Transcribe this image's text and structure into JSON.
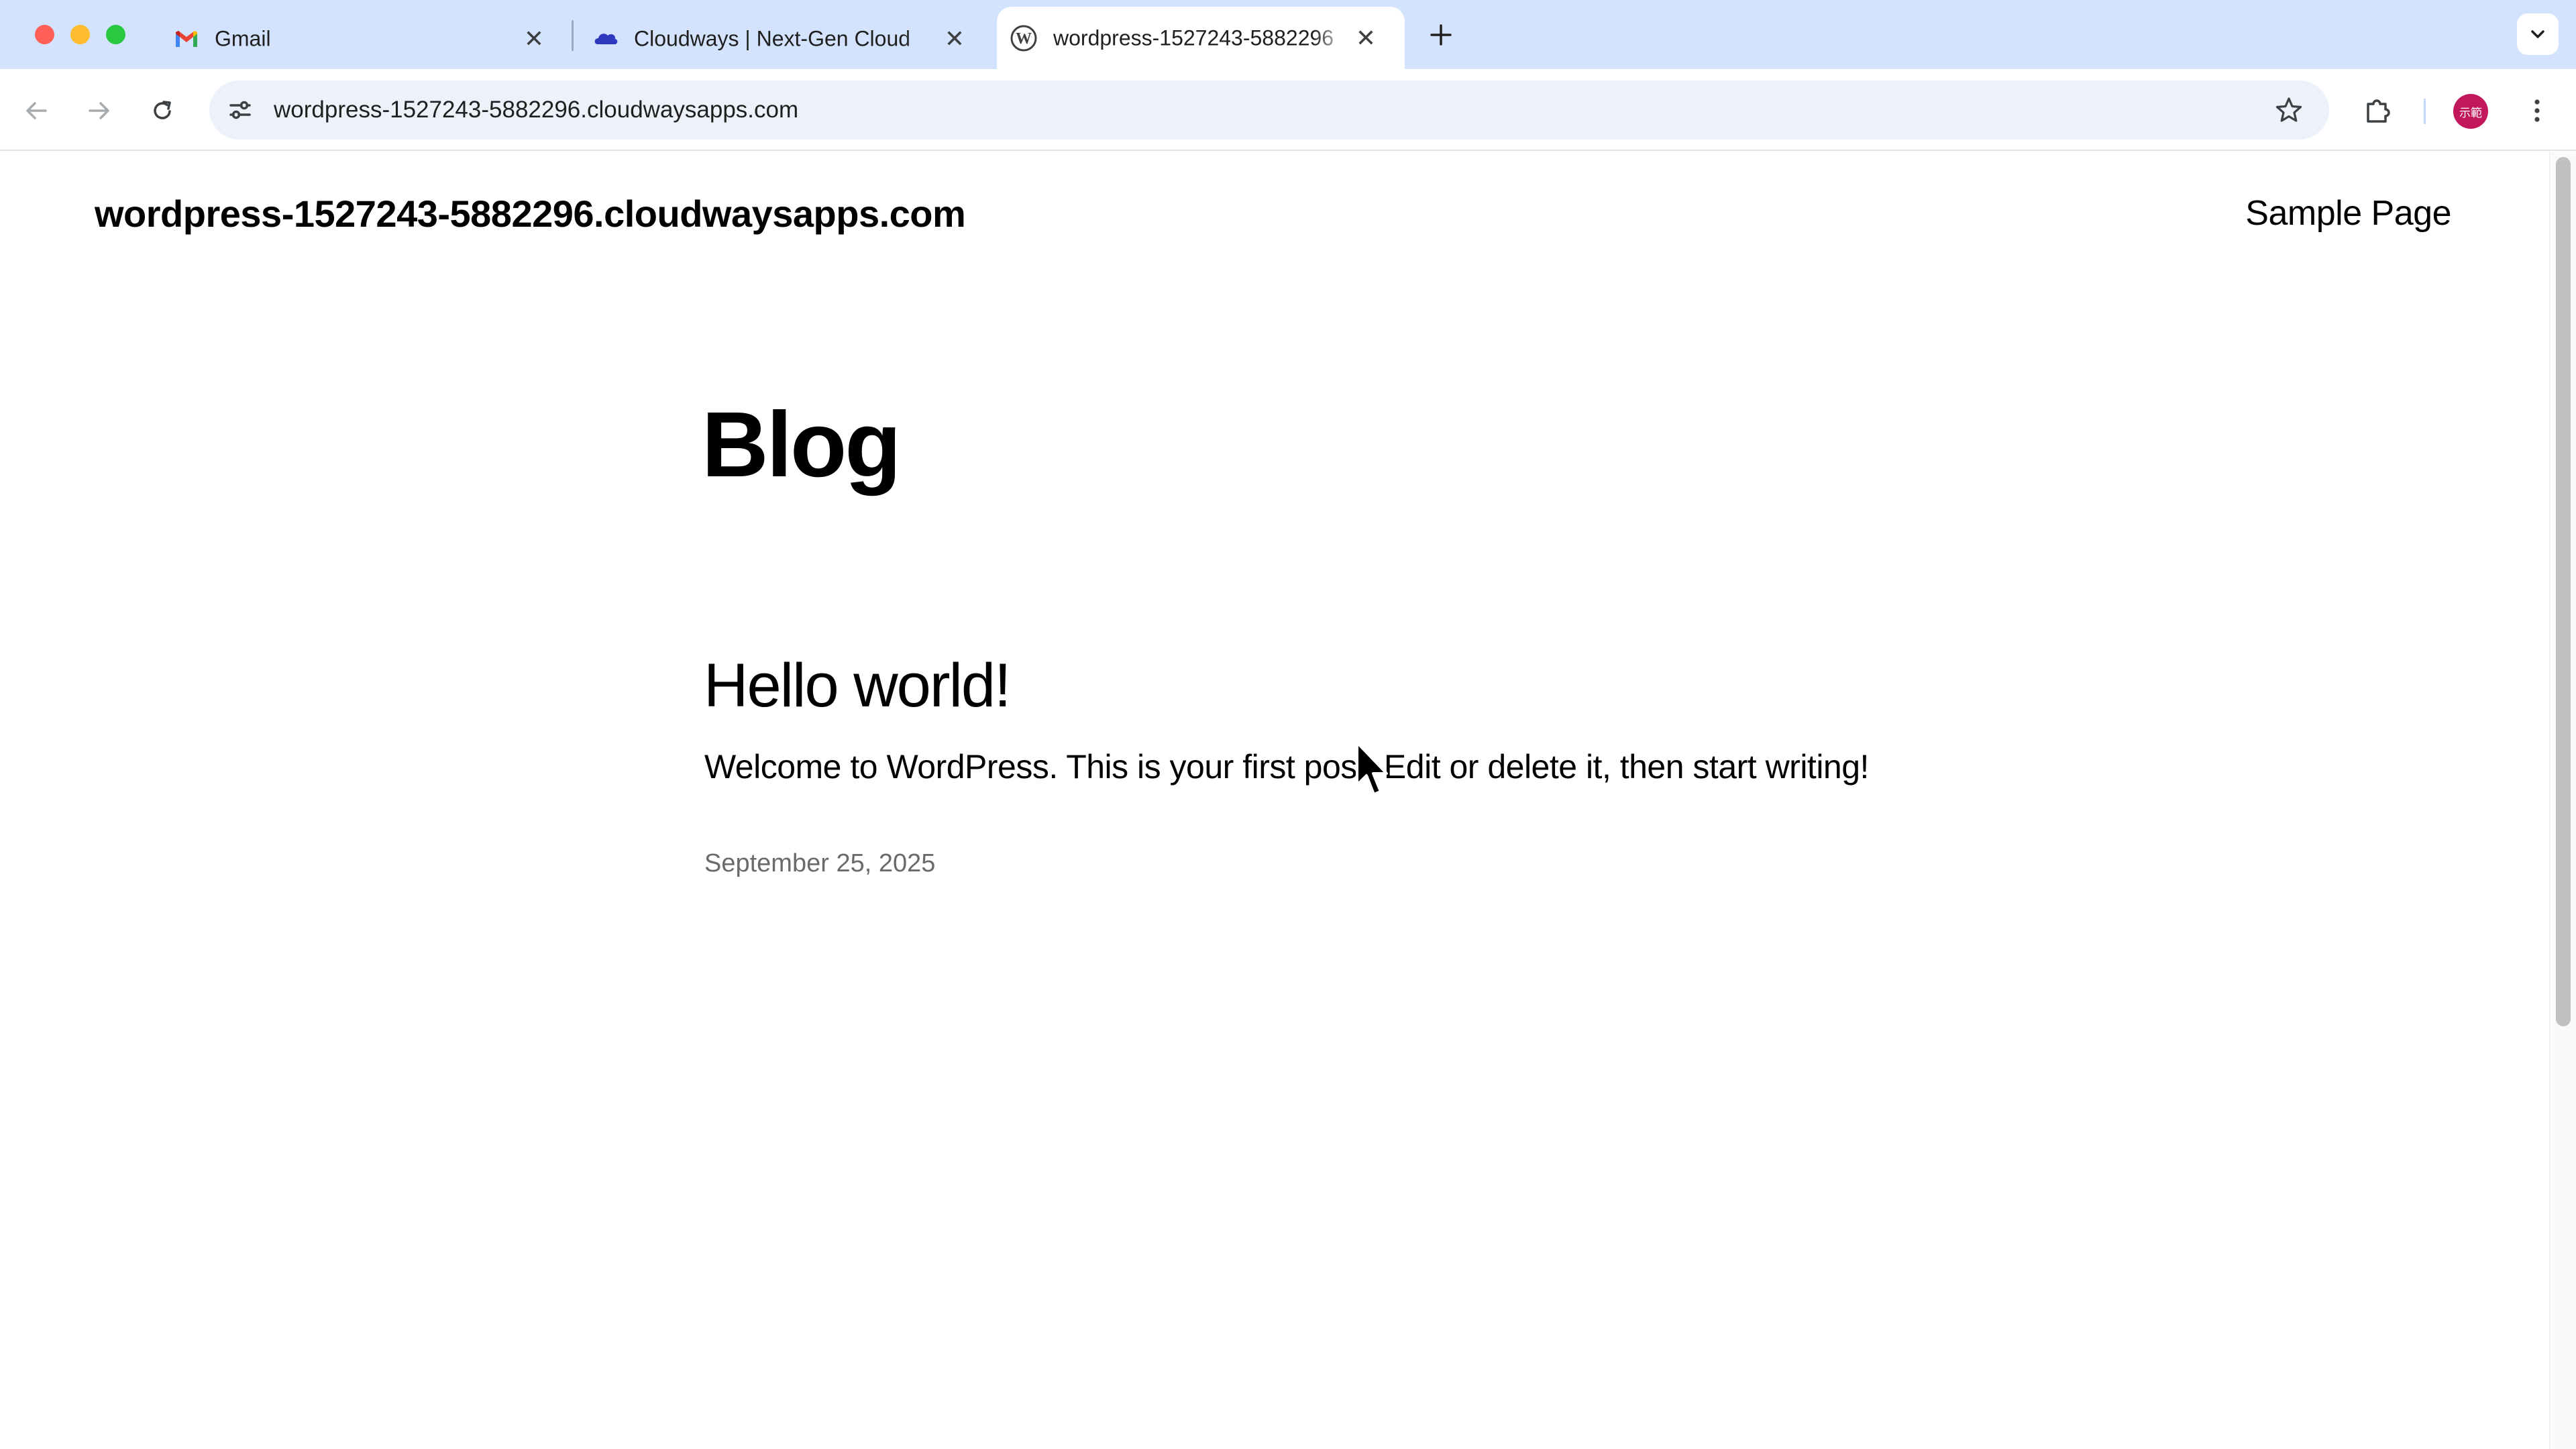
{
  "browser": {
    "tabs": [
      {
        "title": "Gmail",
        "favicon": "gmail-icon",
        "active": false
      },
      {
        "title": "Cloudways | Next-Gen Cloud",
        "favicon": "cloudways-icon",
        "active": false
      },
      {
        "title": "wordpress-1527243-5882296",
        "favicon": "wordpress-icon",
        "active": true
      }
    ],
    "url": "wordpress-1527243-5882296.cloudwaysapps.com",
    "profile_initials": "示範"
  },
  "site": {
    "title": "wordpress-1527243-5882296.cloudwaysapps.com",
    "nav": {
      "sample_page": "Sample Page"
    }
  },
  "page": {
    "heading": "Blog",
    "posts": [
      {
        "title": "Hello world!",
        "excerpt": "Welcome to WordPress. This is your first post. Edit or delete it, then start writing!",
        "date": "September 25, 2025"
      }
    ]
  },
  "colors": {
    "tabstrip_bg": "#d3e3fd",
    "omnibox_bg": "#edf2fa",
    "avatar_bg": "#c2185b",
    "date_text": "#6a6a6a"
  }
}
